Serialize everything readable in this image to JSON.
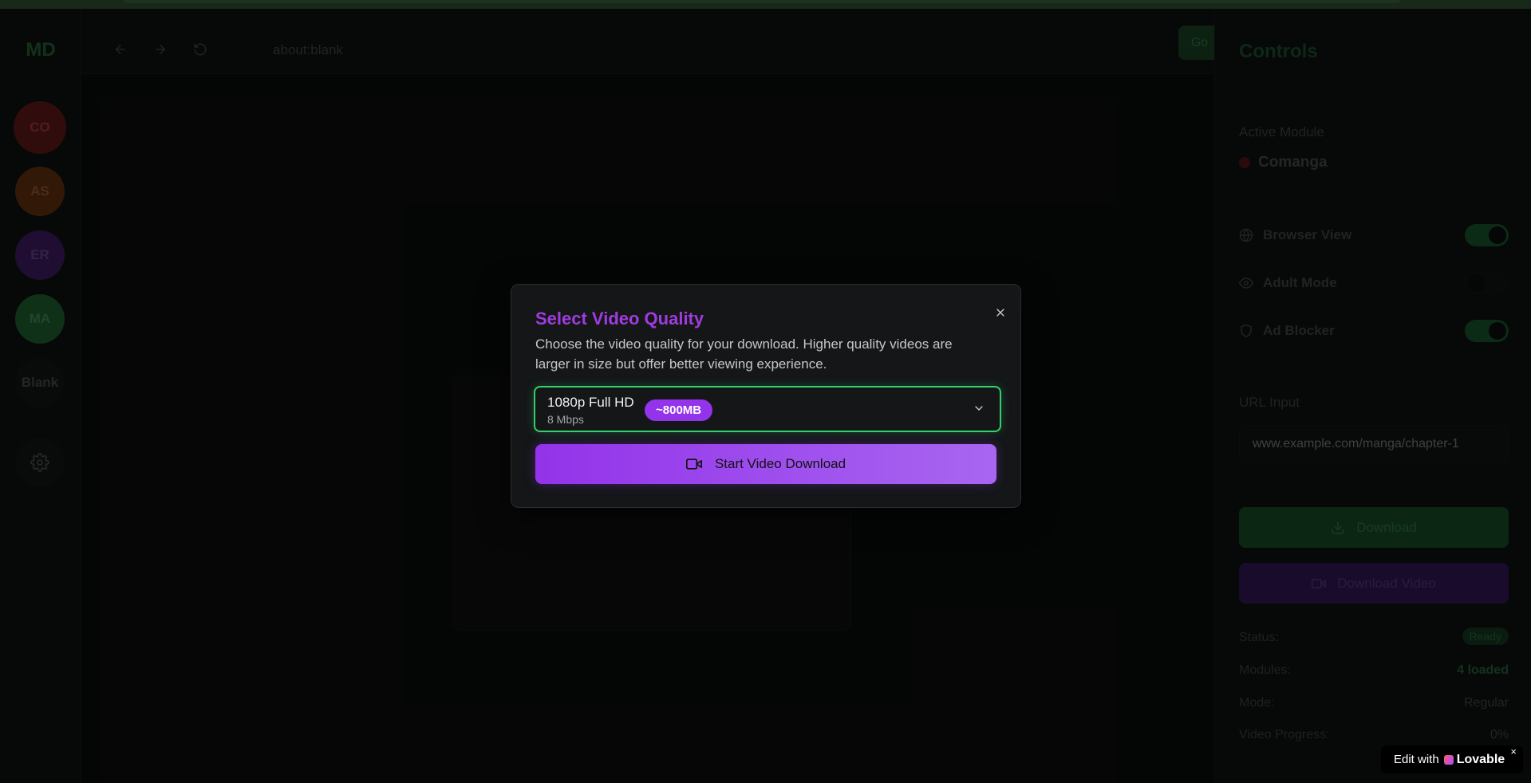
{
  "sidebar": {
    "logo": "MD",
    "modules": [
      {
        "label": "CO"
      },
      {
        "label": "AS"
      },
      {
        "label": "ER"
      },
      {
        "label": "MA"
      },
      {
        "label": "Blank"
      }
    ]
  },
  "browser": {
    "address": "about:blank",
    "go_label": "Go"
  },
  "controls": {
    "title": "Controls",
    "active_module_label": "Active Module",
    "active_module_name": "Comanga",
    "toggles": [
      {
        "label": "Browser View",
        "on": true
      },
      {
        "label": "Adult Mode",
        "on": false
      },
      {
        "label": "Ad Blocker",
        "on": true
      }
    ],
    "url_input_label": "URL Input",
    "url_input_placeholder": "www.example.com/manga/chapter-1",
    "download_label": "Download",
    "download_video_label": "Download Video",
    "status_label": "Status:",
    "status_value": "Ready",
    "modules_label": "Modules:",
    "modules_value": "4 loaded",
    "mode_label": "Mode:",
    "mode_value": "Regular",
    "video_progress_label": "Video Progress:",
    "video_progress_value": "0%"
  },
  "modal": {
    "title": "Select Video Quality",
    "description": "Choose the video quality for your download. Higher quality videos are larger in size but offer better viewing experience.",
    "selected_quality": "1080p Full HD",
    "selected_bitrate": "8 Mbps",
    "selected_size": "~800MB",
    "start_label": "Start Video Download"
  },
  "badge": {
    "prefix": "Edit with",
    "brand": "Lovable",
    "close": "×"
  },
  "colors": {
    "accent_purple": "#9333ea",
    "accent_green": "#34d06a"
  }
}
